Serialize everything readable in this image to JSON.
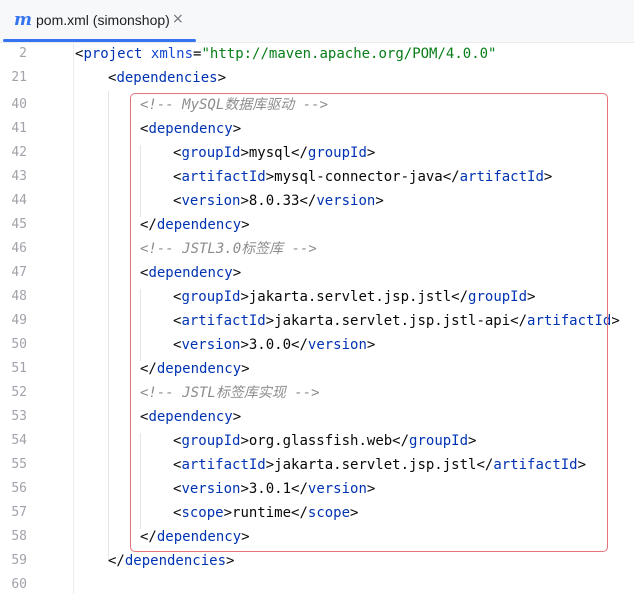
{
  "tab": {
    "title": "pom.xml (simonshop)",
    "icon": "maven-m-icon",
    "icon_glyph": "m",
    "close_glyph": "×"
  },
  "accent_color": "#3574f0",
  "highlight_color": "#e5747b",
  "lines": [
    {
      "num": "2",
      "indent": 0,
      "parts": [
        [
          "p",
          "<"
        ],
        [
          "t",
          "project"
        ],
        [
          "p",
          " "
        ],
        [
          "a",
          "xmlns"
        ],
        [
          "p",
          "="
        ],
        [
          "s",
          "\"http://maven.apache.org/POM/4.0.0\""
        ]
      ]
    },
    {
      "num": "21",
      "indent": 1,
      "parts": [
        [
          "p",
          "<"
        ],
        [
          "t",
          "dependencies"
        ],
        [
          "p",
          ">"
        ]
      ]
    },
    {
      "num": "40",
      "indent": 2,
      "parts": [
        [
          "c",
          "<!-- MySQL数据库驱动 -->"
        ]
      ]
    },
    {
      "num": "41",
      "indent": 2,
      "parts": [
        [
          "p",
          "<"
        ],
        [
          "t",
          "dependency"
        ],
        [
          "p",
          ">"
        ]
      ]
    },
    {
      "num": "42",
      "indent": 3,
      "parts": [
        [
          "p",
          "<"
        ],
        [
          "t",
          "groupId"
        ],
        [
          "p",
          ">mysql</"
        ],
        [
          "t",
          "groupId"
        ],
        [
          "p",
          ">"
        ]
      ]
    },
    {
      "num": "43",
      "indent": 3,
      "parts": [
        [
          "p",
          "<"
        ],
        [
          "t",
          "artifactId"
        ],
        [
          "p",
          ">mysql-connector-java</"
        ],
        [
          "t",
          "artifactId"
        ],
        [
          "p",
          ">"
        ]
      ]
    },
    {
      "num": "44",
      "indent": 3,
      "parts": [
        [
          "p",
          "<"
        ],
        [
          "t",
          "version"
        ],
        [
          "p",
          ">8.0.33</"
        ],
        [
          "t",
          "version"
        ],
        [
          "p",
          ">"
        ]
      ]
    },
    {
      "num": "45",
      "indent": 2,
      "parts": [
        [
          "p",
          "</"
        ],
        [
          "t",
          "dependency"
        ],
        [
          "p",
          ">"
        ]
      ]
    },
    {
      "num": "46",
      "indent": 2,
      "parts": [
        [
          "c",
          "<!-- JSTL3.0标签库 -->"
        ]
      ]
    },
    {
      "num": "47",
      "indent": 2,
      "parts": [
        [
          "p",
          "<"
        ],
        [
          "t",
          "dependency"
        ],
        [
          "p",
          ">"
        ]
      ]
    },
    {
      "num": "48",
      "indent": 3,
      "parts": [
        [
          "p",
          "<"
        ],
        [
          "t",
          "groupId"
        ],
        [
          "p",
          ">jakarta.servlet.jsp.jstl</"
        ],
        [
          "t",
          "groupId"
        ],
        [
          "p",
          ">"
        ]
      ]
    },
    {
      "num": "49",
      "indent": 3,
      "parts": [
        [
          "p",
          "<"
        ],
        [
          "t",
          "artifactId"
        ],
        [
          "p",
          ">jakarta.servlet.jsp.jstl-api</"
        ],
        [
          "t",
          "artifactId"
        ],
        [
          "p",
          ">"
        ]
      ]
    },
    {
      "num": "50",
      "indent": 3,
      "parts": [
        [
          "p",
          "<"
        ],
        [
          "t",
          "version"
        ],
        [
          "p",
          ">3.0.0</"
        ],
        [
          "t",
          "version"
        ],
        [
          "p",
          ">"
        ]
      ]
    },
    {
      "num": "51",
      "indent": 2,
      "parts": [
        [
          "p",
          "</"
        ],
        [
          "t",
          "dependency"
        ],
        [
          "p",
          ">"
        ]
      ]
    },
    {
      "num": "52",
      "indent": 2,
      "parts": [
        [
          "c",
          "<!-- JSTL标签库实现 -->"
        ]
      ]
    },
    {
      "num": "53",
      "indent": 2,
      "parts": [
        [
          "p",
          "<"
        ],
        [
          "t",
          "dependency"
        ],
        [
          "p",
          ">"
        ]
      ]
    },
    {
      "num": "54",
      "indent": 3,
      "parts": [
        [
          "p",
          "<"
        ],
        [
          "t",
          "groupId"
        ],
        [
          "p",
          ">org.glassfish.web</"
        ],
        [
          "t",
          "groupId"
        ],
        [
          "p",
          ">"
        ]
      ]
    },
    {
      "num": "55",
      "indent": 3,
      "parts": [
        [
          "p",
          "<"
        ],
        [
          "t",
          "artifactId"
        ],
        [
          "p",
          ">jakarta.servlet.jsp.jstl</"
        ],
        [
          "t",
          "artifactId"
        ],
        [
          "p",
          ">"
        ]
      ]
    },
    {
      "num": "56",
      "indent": 3,
      "parts": [
        [
          "p",
          "<"
        ],
        [
          "t",
          "version"
        ],
        [
          "p",
          ">3.0.1</"
        ],
        [
          "t",
          "version"
        ],
        [
          "p",
          ">"
        ]
      ]
    },
    {
      "num": "57",
      "indent": 3,
      "parts": [
        [
          "p",
          "<"
        ],
        [
          "t",
          "scope"
        ],
        [
          "p",
          ">runtime</"
        ],
        [
          "t",
          "scope"
        ],
        [
          "p",
          ">"
        ]
      ]
    },
    {
      "num": "58",
      "indent": 2,
      "parts": [
        [
          "p",
          "</"
        ],
        [
          "t",
          "dependency"
        ],
        [
          "p",
          ">"
        ]
      ]
    },
    {
      "num": "59",
      "indent": 1,
      "parts": [
        [
          "p",
          "</"
        ],
        [
          "t",
          "dependencies"
        ],
        [
          "p",
          ">"
        ]
      ]
    },
    {
      "num": "60",
      "indent": 0,
      "parts": []
    }
  ]
}
